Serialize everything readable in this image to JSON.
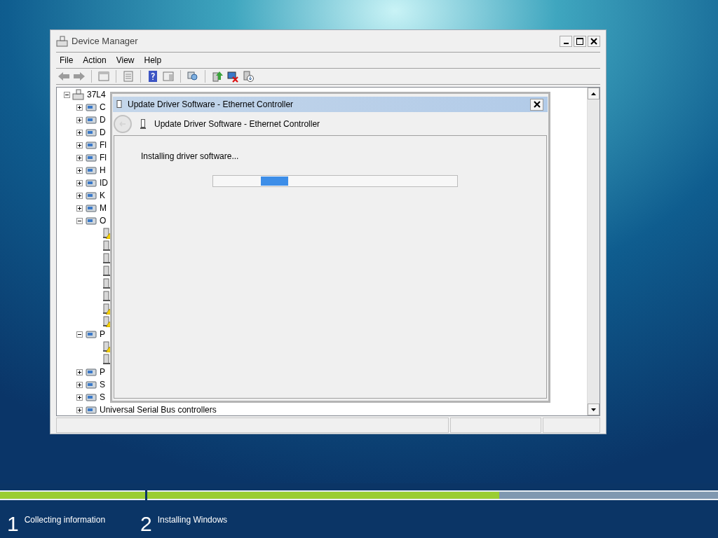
{
  "device_manager": {
    "title": "Device Manager",
    "menu": [
      {
        "label": "File"
      },
      {
        "label": "Action"
      },
      {
        "label": "View"
      },
      {
        "label": "Help"
      }
    ],
    "tree": {
      "label": "37L4",
      "expanded": true,
      "children": [
        {
          "label": "C",
          "expanded": false
        },
        {
          "label": "D",
          "expanded": false
        },
        {
          "label": "D",
          "expanded": false
        },
        {
          "label": "Fl",
          "expanded": false
        },
        {
          "label": "Fl",
          "expanded": false
        },
        {
          "label": "H",
          "expanded": false
        },
        {
          "label": "ID",
          "expanded": false
        },
        {
          "label": "K",
          "expanded": false
        },
        {
          "label": "M",
          "expanded": false
        },
        {
          "label": "O",
          "expanded": true,
          "children": [
            {
              "warning": true
            },
            {
              "warning": false
            },
            {
              "warning": false
            },
            {
              "warning": false
            },
            {
              "warning": false
            },
            {
              "warning": false
            },
            {
              "warning": true
            },
            {
              "warning": true
            }
          ]
        },
        {
          "label": "P",
          "expanded": true,
          "children": [
            {
              "warning": true
            },
            {
              "warning": false
            }
          ]
        },
        {
          "label": "P",
          "expanded": false
        },
        {
          "label": "S",
          "expanded": false
        },
        {
          "label": "S",
          "expanded": false
        },
        {
          "label": "Universal Serial Bus controllers",
          "expanded": false
        }
      ]
    }
  },
  "dialog": {
    "title": "Update Driver Software - Ethernet Controller",
    "header": "Update Driver Software - Ethernet Controller",
    "message": "Installing driver software..."
  },
  "setup": {
    "steps": [
      {
        "number": "1",
        "label": "Collecting information",
        "level": 1
      },
      {
        "number": "2",
        "label": "Installing Windows",
        "level": 0.617
      }
    ]
  }
}
